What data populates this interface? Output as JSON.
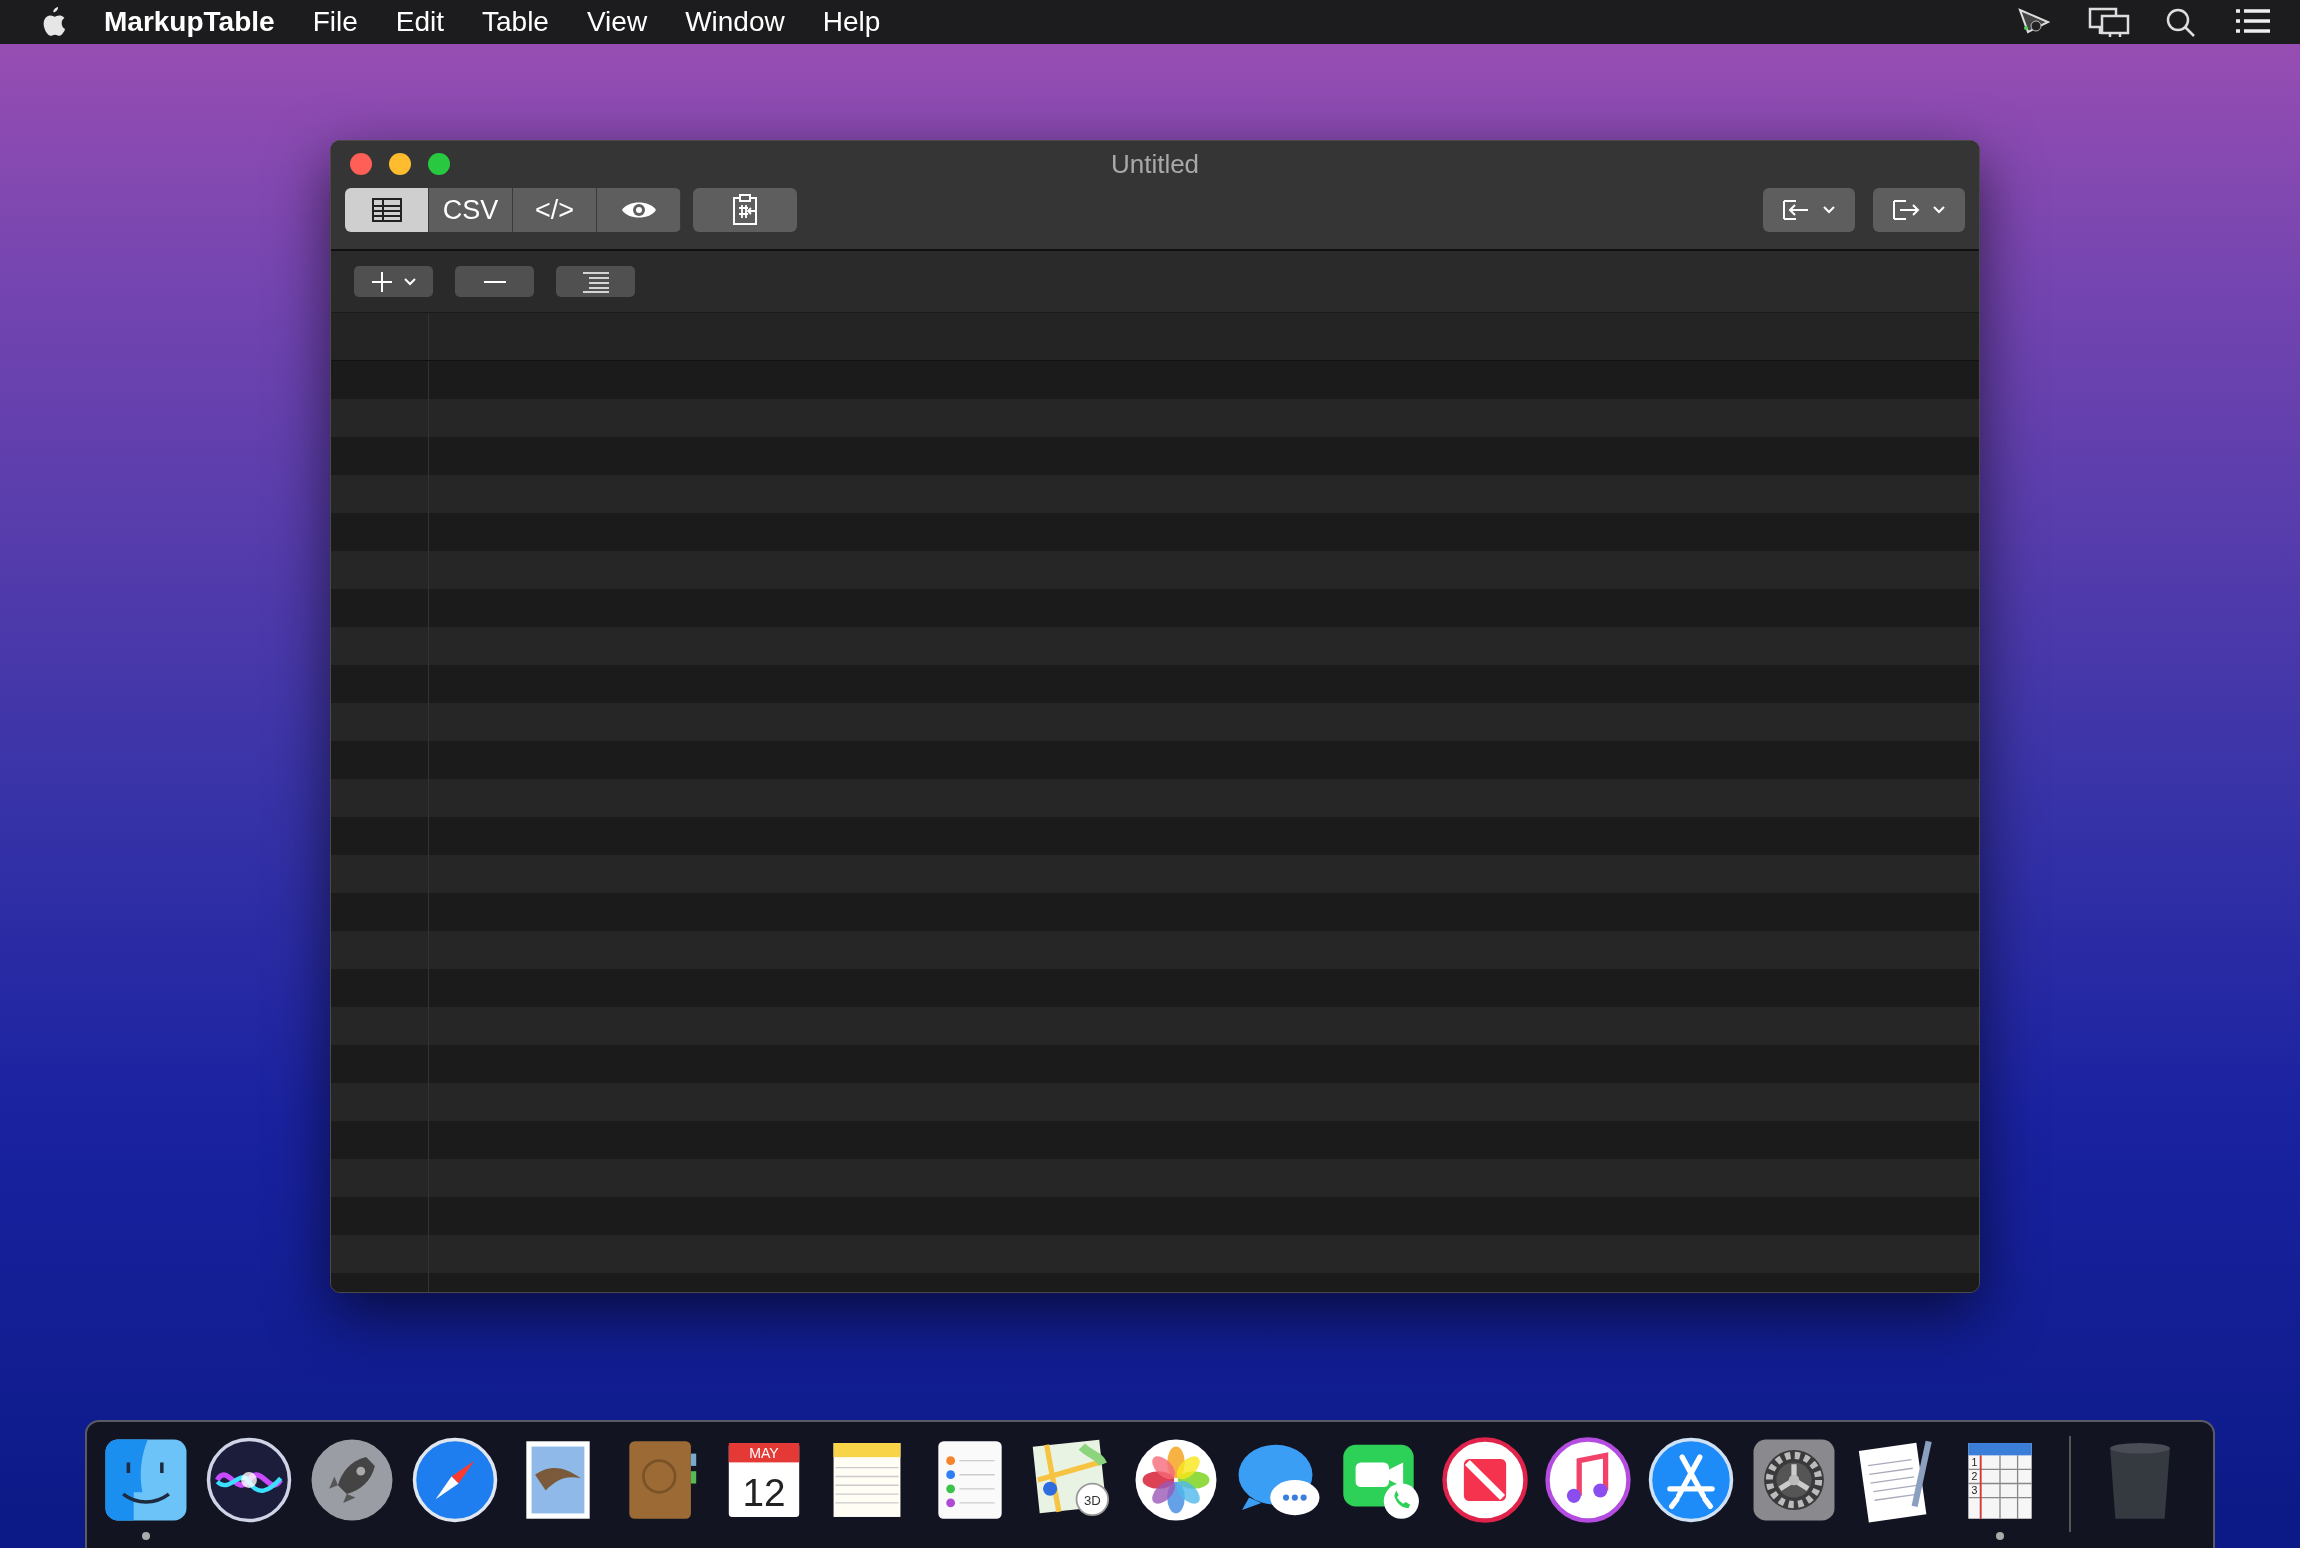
{
  "menu_bar": {
    "app_name": "MarkupTable",
    "menus": [
      "File",
      "Edit",
      "Table",
      "View",
      "Window",
      "Help"
    ]
  },
  "window": {
    "title": "Untitled"
  },
  "toolbar": {
    "view_modes": [
      {
        "kind": "table",
        "selected": true
      },
      {
        "kind": "text",
        "label": "CSV",
        "selected": false
      },
      {
        "kind": "text",
        "label": "</>",
        "selected": false
      },
      {
        "kind": "preview",
        "selected": false
      }
    ]
  },
  "dock": {
    "items": [
      {
        "kind": "finder",
        "running": true
      },
      {
        "kind": "siri",
        "running": false
      },
      {
        "kind": "launchpad",
        "running": false
      },
      {
        "kind": "safari",
        "running": false
      },
      {
        "kind": "mail",
        "running": false
      },
      {
        "kind": "contacts",
        "running": false
      },
      {
        "kind": "calendar",
        "running": false,
        "month": "MAY",
        "day": "12"
      },
      {
        "kind": "notes",
        "running": false
      },
      {
        "kind": "reminders",
        "running": false
      },
      {
        "kind": "maps",
        "running": false,
        "badge": "3D"
      },
      {
        "kind": "photos",
        "running": false
      },
      {
        "kind": "messages",
        "running": false
      },
      {
        "kind": "facetime",
        "running": false
      },
      {
        "kind": "news",
        "running": false
      },
      {
        "kind": "music",
        "running": false
      },
      {
        "kind": "appstore",
        "running": false
      },
      {
        "kind": "settings",
        "running": false
      },
      {
        "kind": "textedit",
        "running": false
      },
      {
        "kind": "spreadsheet",
        "running": true,
        "row_numbers": [
          "1",
          "2",
          "3"
        ]
      },
      {
        "kind": "separator"
      },
      {
        "kind": "trash",
        "running": false
      }
    ]
  }
}
